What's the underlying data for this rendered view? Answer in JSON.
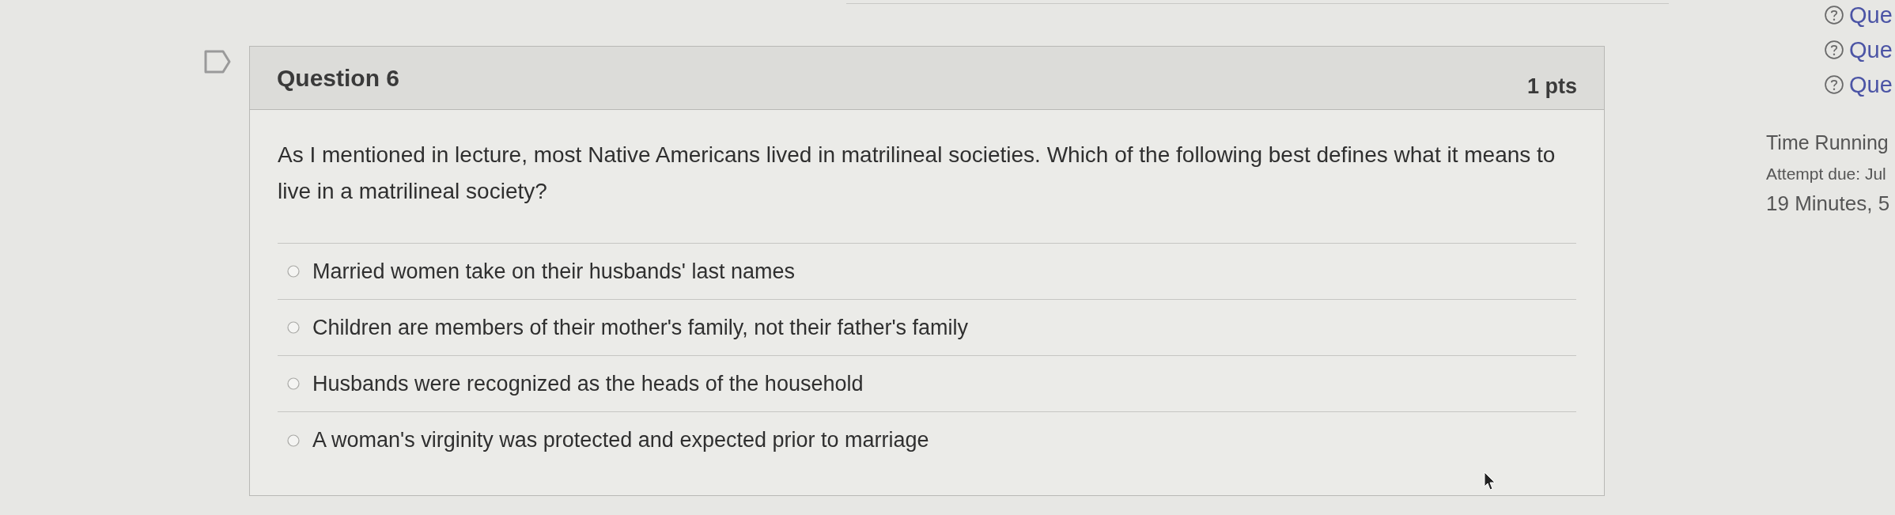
{
  "bookmark": {
    "flagged": false
  },
  "question": {
    "title": "Question 6",
    "points": "1 pts",
    "text": "As I mentioned in lecture, most Native Americans lived in matrilineal societies. Which of the following best defines what it means to live in a matrilineal society?",
    "answers": [
      {
        "label": "Married women take on their husbands' last names",
        "selected": false
      },
      {
        "label": "Children are members of their mother's family, not their father's family",
        "selected": false
      },
      {
        "label": "Husbands were recognized as the heads of the household",
        "selected": false
      },
      {
        "label": "A woman's virginity was protected and expected prior to marriage",
        "selected": false
      }
    ]
  },
  "sidebar": {
    "questions": [
      {
        "label": "Que"
      },
      {
        "label": "Que"
      },
      {
        "label": "Que"
      }
    ],
    "timer": {
      "heading": "Time Running",
      "attempt_due": "Attempt due: Jul",
      "remaining": "19 Minutes, 5"
    }
  }
}
